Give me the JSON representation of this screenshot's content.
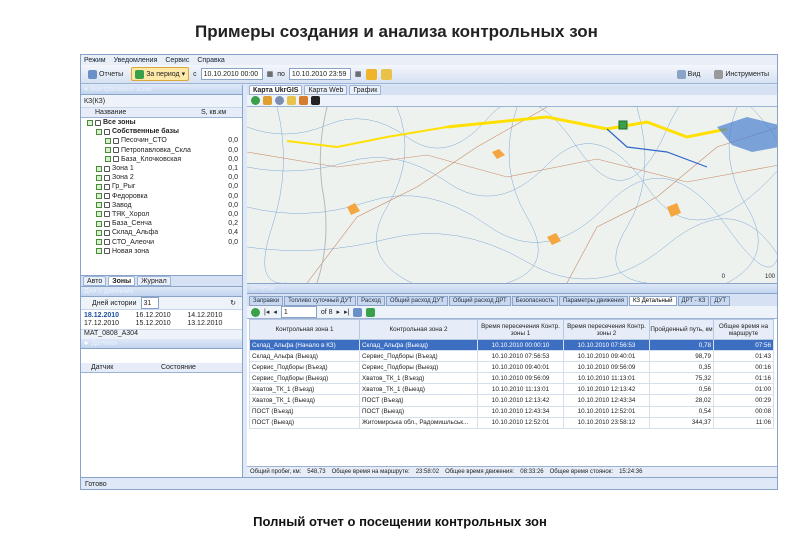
{
  "slide": {
    "title": "Примеры создания и анализа контрольных зон",
    "caption": "Полный отчет о посещении контрольных зон"
  },
  "menu": [
    "Режим",
    "Уведомления",
    "Сервис",
    "Справка"
  ],
  "toolbar": {
    "reports": "Отчеты",
    "period": "За период",
    "from_label": "с",
    "from_value": "10.10.2010 00:00",
    "to_label": "по",
    "to_value": "10.10.2010 23:59",
    "view": "Вид",
    "tools": "Инструменты"
  },
  "left": {
    "zones_title": "Контрольные зоны",
    "search_value": "КЗ(КЗ)",
    "col_name": "Название",
    "col_area": "S, кв.км",
    "tree": [
      {
        "label": "Все зоны",
        "value": "",
        "level": 0,
        "bold": true
      },
      {
        "label": "Собственные базы",
        "value": "",
        "level": 1,
        "bold": true
      },
      {
        "label": "Песочин_СТО",
        "value": "0,0",
        "level": 2
      },
      {
        "label": "Петропавловка_Скла",
        "value": "0,0",
        "level": 2
      },
      {
        "label": "База_Клочковская",
        "value": "0,0",
        "level": 2
      },
      {
        "label": "Зона 1",
        "value": "0,1",
        "level": 1
      },
      {
        "label": "Зона 2",
        "value": "0,0",
        "level": 1
      },
      {
        "label": "Гр_Рыг",
        "value": "0,0",
        "level": 1
      },
      {
        "label": "Федоровка",
        "value": "0,0",
        "level": 1
      },
      {
        "label": "Завод",
        "value": "0,0",
        "level": 1
      },
      {
        "label": "ТЯК_Хорол",
        "value": "0,0",
        "level": 1
      },
      {
        "label": "База_Сенча",
        "value": "0,2",
        "level": 1
      },
      {
        "label": "Склад_Альфа",
        "value": "0,4",
        "level": 1
      },
      {
        "label": "СТО_Алеочи",
        "value": "0,0",
        "level": 1
      },
      {
        "label": "Новая зона",
        "value": "",
        "level": 1
      }
    ],
    "tabs": [
      "Авто",
      "Зоны",
      "Журнал"
    ],
    "days_title": "Дни с данными",
    "days_label": "Дней истории",
    "days_value": "31",
    "dates": [
      "18.12.2010",
      "16.12.2010",
      "14.12.2010",
      "17.12.2010",
      "15.12.2010",
      "13.12.2010"
    ],
    "vehicle": "MAT_0808_A304",
    "sensors_title": "Датчики",
    "sensor_col1": "Датчик",
    "sensor_col2": "Состояние"
  },
  "map": {
    "tabs": [
      "Карта UkrGIS",
      "Карта Web",
      "График"
    ],
    "scale_left": "0",
    "scale_right": "100"
  },
  "report": {
    "title": "Отчеты",
    "tabs": [
      "Заправки",
      "Топливо суточный ДУТ",
      "Расход",
      "Общий расход ДУТ",
      "Общий расход ДРТ",
      "Безопасность",
      "Параметры движения",
      "КЗ Детальный",
      "ДРТ - КЗ",
      "ДУТ"
    ],
    "page_current": "1",
    "page_of": "of 8",
    "columns": [
      "Контрольная зона 1",
      "Контрольная зона 2",
      "Время пересечения Контр. зоны 1",
      "Время пересечения Контр. зоны 2",
      "Пройденный путь, км",
      "Общее время на маршруте"
    ],
    "rows": [
      [
        "Склад_Альфа (Начало в КЗ)",
        "Склад_Альфа (Выезд)",
        "10.10.2010 00:00:10",
        "10.10.2010 07:56:53",
        "0,78",
        "07:56"
      ],
      [
        "Склад_Альфа (Выезд)",
        "Сервис_Подборы (Въезд)",
        "10.10.2010 07:56:53",
        "10.10.2010 09:40:01",
        "98,79",
        "01:43"
      ],
      [
        "Сервис_Подборы (Въезд)",
        "Сервис_Подборы (Выезд)",
        "10.10.2010 09:40:01",
        "10.10.2010 09:56:09",
        "0,35",
        "00:16"
      ],
      [
        "Сервис_Подборы (Выезд)",
        "Хватов_ТК_1 (Въезд)",
        "10.10.2010 09:56:09",
        "10.10.2010 11:13:01",
        "75,32",
        "01:16"
      ],
      [
        "Хватов_ТК_1 (Въезд)",
        "Хватов_ТК_1 (Выезд)",
        "10.10.2010 11:13:01",
        "10.10.2010 12:13:42",
        "0,56",
        "01:00"
      ],
      [
        "Хватов_ТК_1 (Выезд)",
        "ПОСТ (Въезд)",
        "10.10.2010 12:13:42",
        "10.10.2010 12:43:34",
        "28,02",
        "00:29"
      ],
      [
        "ПОСТ (Въезд)",
        "ПОСТ (Выезд)",
        "10.10.2010 12:43:34",
        "10.10.2010 12:52:01",
        "0,54",
        "00:08"
      ],
      [
        "ПОСТ (Выезд)",
        "Житомирська обл., Радомишльськ...",
        "10.10.2010 12:52:01",
        "10.10.2010 23:58:12",
        "344,37",
        "11:06"
      ]
    ],
    "summary": [
      {
        "label": "Общий пробег, км:",
        "value": "548,73"
      },
      {
        "label": "Общее время на маршруте:",
        "value": "23:58:02"
      },
      {
        "label": "Общее время движения:",
        "value": "08:33:26"
      },
      {
        "label": "Общее время стоянок:",
        "value": "15:24:36"
      }
    ]
  },
  "status": "Готово"
}
